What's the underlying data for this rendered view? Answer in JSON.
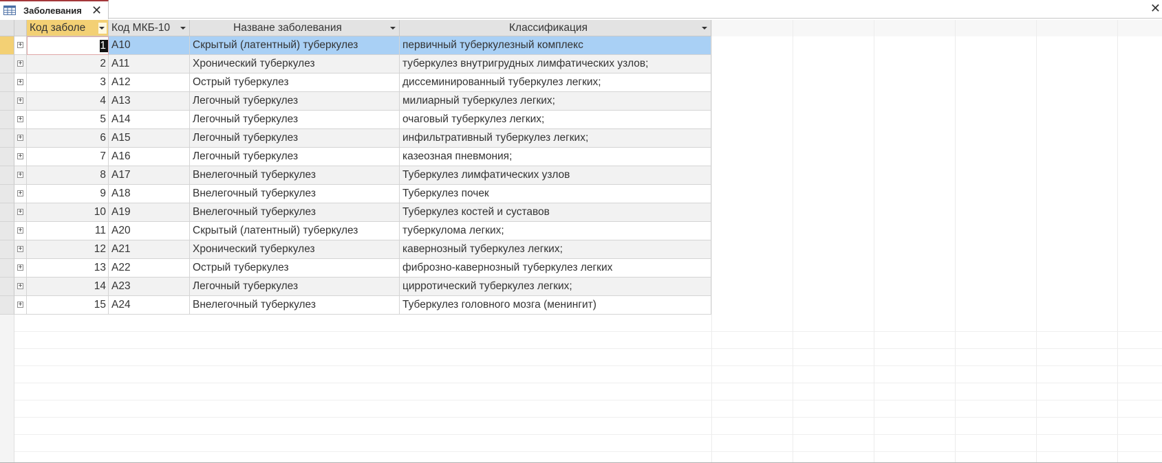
{
  "window": {
    "tab_title": "Заболевания",
    "tab_close_icon": "close-icon",
    "window_close_icon": "close-icon"
  },
  "table": {
    "columns": [
      {
        "key": "id",
        "label": "Код заболе",
        "selected": true,
        "sortable": true
      },
      {
        "key": "mkb",
        "label": "Код МКБ-10",
        "selected": false,
        "sortable": true
      },
      {
        "key": "name",
        "label": "Назване заболевания",
        "selected": false,
        "sortable": true
      },
      {
        "key": "class",
        "label": "Классификация",
        "selected": false,
        "sortable": true
      }
    ],
    "current_row": 0,
    "rows": [
      {
        "id": "1",
        "mkb": "A10",
        "name": "Скрытый (латентный) туберкулез",
        "class": "первичный туберкулезный комплекс"
      },
      {
        "id": "2",
        "mkb": "A11",
        "name": "Хронический туберкулез",
        "class": "туберкулез внутригрудных лимфатических узлов;"
      },
      {
        "id": "3",
        "mkb": "A12",
        "name": "Острый туберкулез",
        "class": "диссеминированный туберкулез легких;"
      },
      {
        "id": "4",
        "mkb": "A13",
        "name": "Легочный туберкулез",
        "class": "милиарный туберкулез легких;"
      },
      {
        "id": "5",
        "mkb": "A14",
        "name": "Легочный туберкулез",
        "class": "очаговый туберкулез легких;"
      },
      {
        "id": "6",
        "mkb": "A15",
        "name": "Легочный туберкулез",
        "class": "инфильтративный туберкулез легких;"
      },
      {
        "id": "7",
        "mkb": "A16",
        "name": "Легочный туберкулез",
        "class": "казеозная пневмония;"
      },
      {
        "id": "8",
        "mkb": "A17",
        "name": "Внелегочный туберкулез",
        "class": "Туберкулез лимфатических узлов"
      },
      {
        "id": "9",
        "mkb": "A18",
        "name": "Внелегочный туберкулез",
        "class": "Туберкулез почек"
      },
      {
        "id": "10",
        "mkb": "A19",
        "name": "Внелегочный туберкулез",
        "class": "Туберкулез костей и суставов"
      },
      {
        "id": "11",
        "mkb": "A20",
        "name": "Скрытый (латентный) туберкулез",
        "class": "туберкулома легких;"
      },
      {
        "id": "12",
        "mkb": "A21",
        "name": "Хронический туберкулез",
        "class": "кавернозный туберкулез легких;"
      },
      {
        "id": "13",
        "mkb": "A22",
        "name": "Острый туберкулез",
        "class": "фиброзно-кавернозный туберкулез легких"
      },
      {
        "id": "14",
        "mkb": "A23",
        "name": "Легочный туберкулез",
        "class": "цирротический туберкулез легких;"
      },
      {
        "id": "15",
        "mkb": "A24",
        "name": "Внелегочный туберкулез",
        "class": "Туберкулез головного мозга (менингит)"
      }
    ]
  },
  "colors": {
    "selected_header": "#f3d074",
    "selected_row": "#a9d0f5",
    "alt_row": "#f2f2f2",
    "tab_accent": "#a4373a"
  }
}
